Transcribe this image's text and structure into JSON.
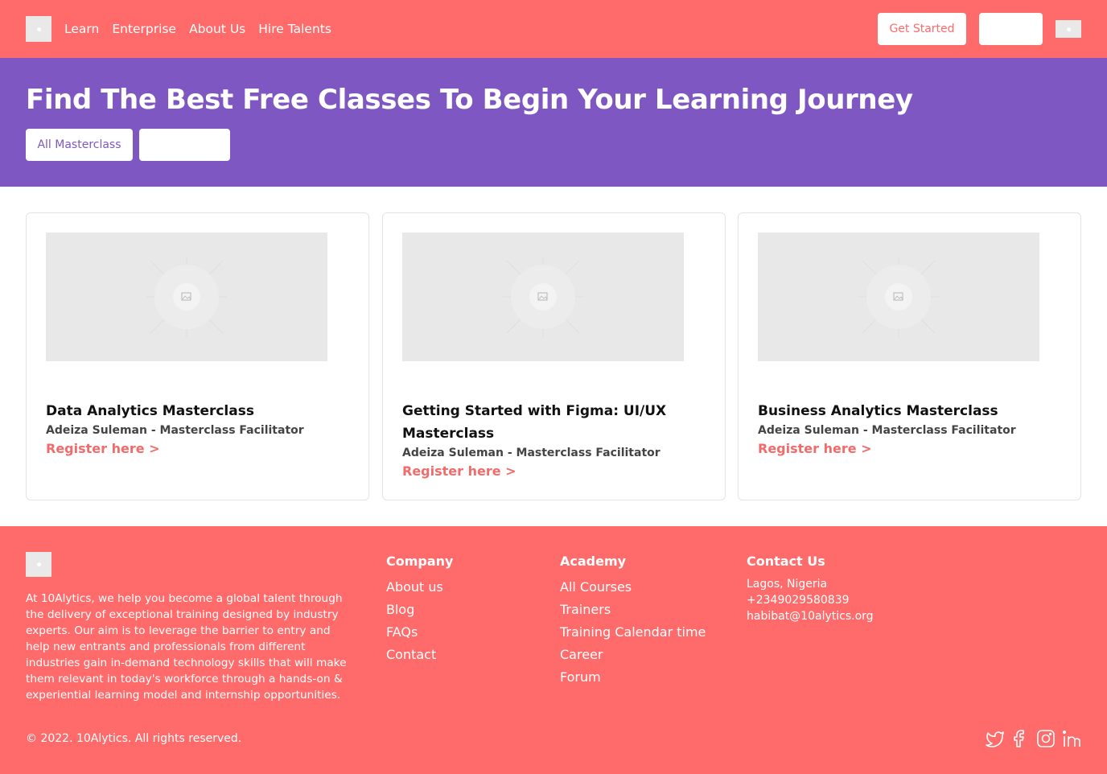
{
  "nav": {
    "logo_icon": "logo-placeholder",
    "links": [
      "Learn",
      "Enterprise",
      "About Us",
      "Hire Talents"
    ],
    "get_started": "Get Started",
    "accent_color": "#ff6b6b"
  },
  "hero": {
    "title": "Find The Best Free Classes To Begin Your Learning Journey",
    "tabs": [
      "All Masterclass"
    ],
    "bg_color": "#7e57c2"
  },
  "cards": [
    {
      "title": "Data Analytics Masterclass",
      "meta": "Adeiza Suleman - Masterclass Facilitator",
      "link": "Register here >"
    },
    {
      "title": "Getting Started with Figma: UI/UX Masterclass",
      "meta": "Adeiza Suleman - Masterclass Facilitator",
      "link": "Register here >"
    },
    {
      "title": "Business Analytics Masterclass",
      "meta": "Adeiza Suleman - Masterclass Facilitator",
      "link": "Register here >"
    }
  ],
  "footer": {
    "about": "At 10Alytics, we help you become a global talent through the delivery of exceptional training designed by industry experts. Our aim is to leverage the barrier to entry and help new entrants and professionals from different industries gain in-demand technology skills that will make them relevant in today's workforce through a hands-on & experiential learning model and internship opportunities.",
    "company": {
      "heading": "Company",
      "links": [
        "About us",
        "Blog",
        "FAQs",
        "Contact"
      ]
    },
    "academy": {
      "heading": "Academy",
      "links": [
        "All Courses",
        "Trainers",
        "Training Calendar time",
        "Career",
        "Forum"
      ]
    },
    "contact": {
      "heading": "Contact Us",
      "location": "Lagos, Nigeria",
      "phone": "+2349029580839",
      "email": "habibat@10alytics.org"
    },
    "copyright": "© 2022. 10Alytics. All rights reserved.",
    "social_icons": [
      "twitter-icon",
      "facebook-icon",
      "instagram-icon",
      "linkedin-icon"
    ]
  }
}
